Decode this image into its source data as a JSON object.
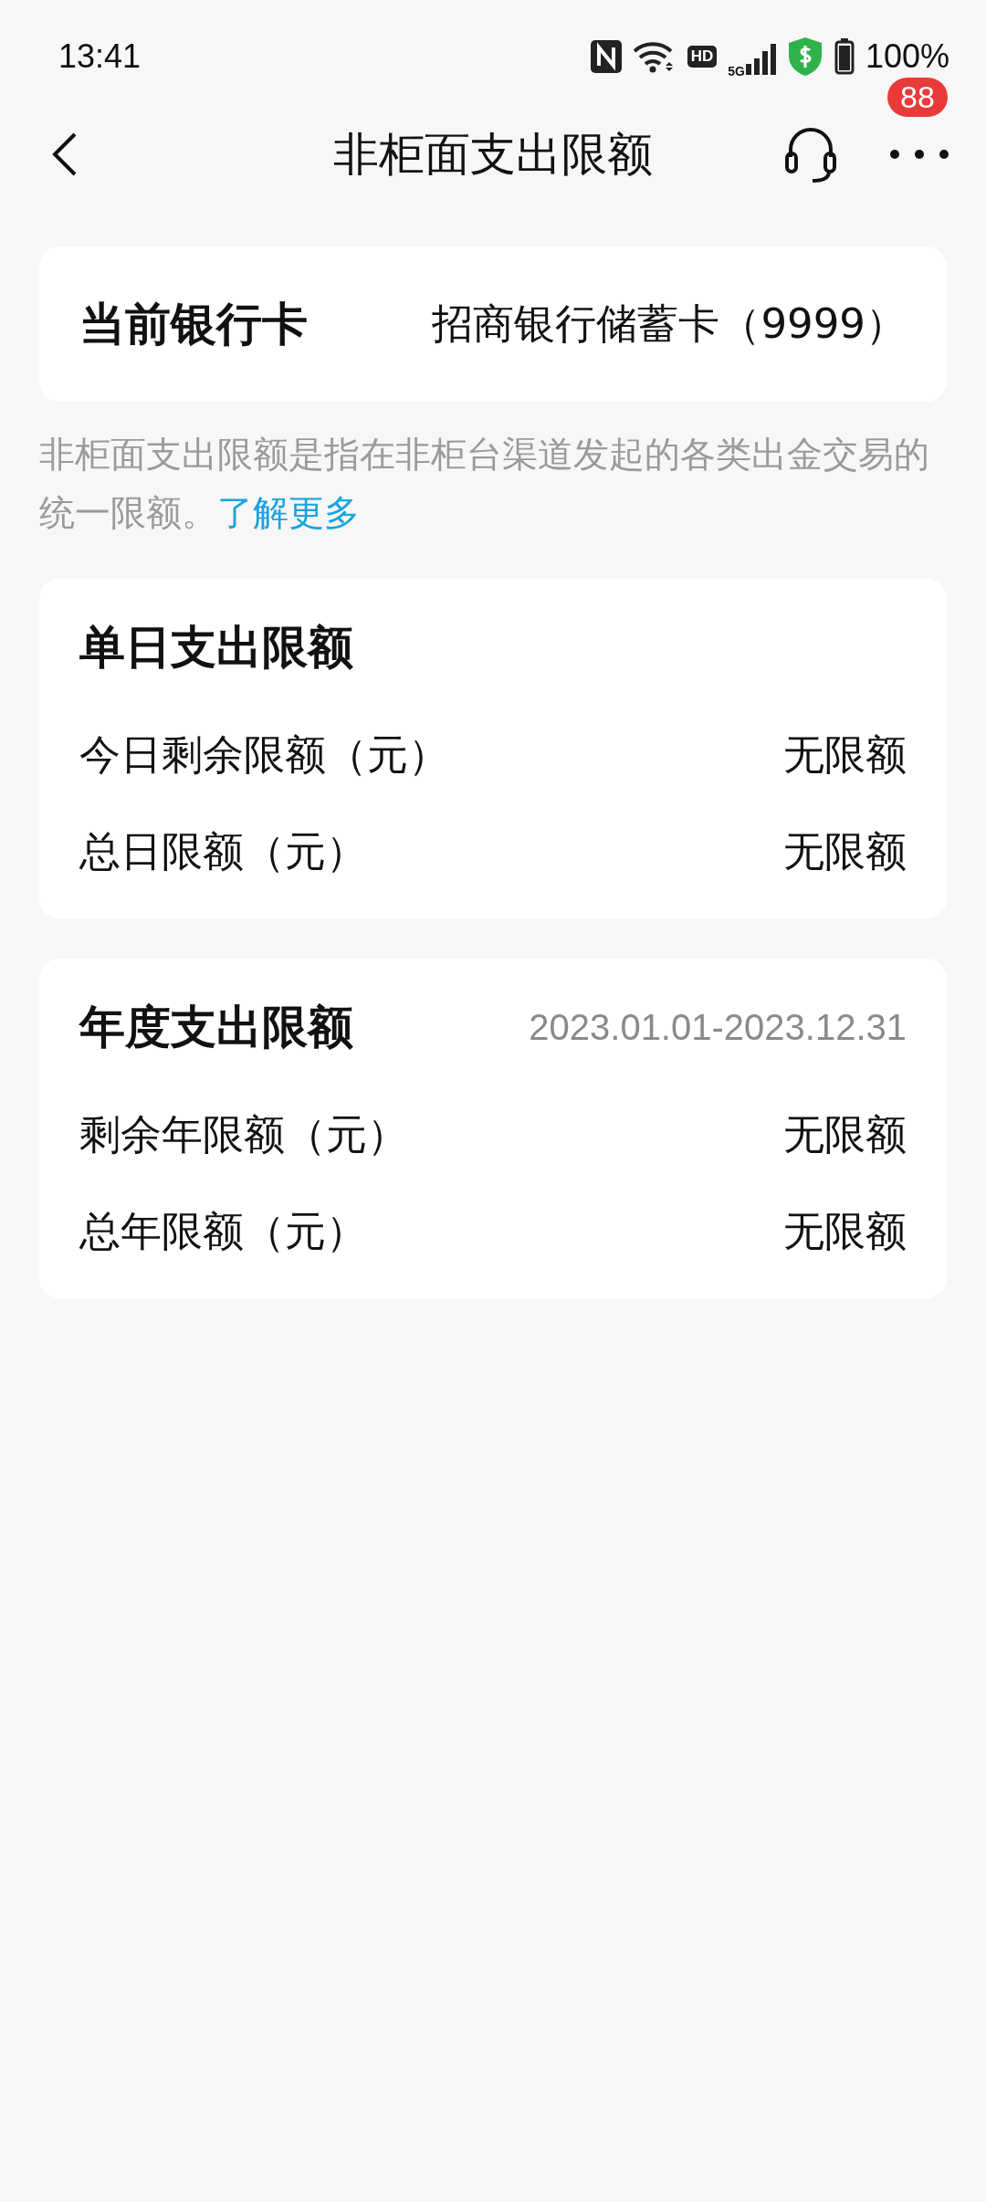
{
  "status_bar": {
    "time": "13:41",
    "hd": "HD",
    "network": "5G",
    "battery": "100%"
  },
  "header": {
    "title": "非柜面支出限额",
    "badge": "88"
  },
  "card_info": {
    "label": "当前银行卡",
    "value": "招商银行储蓄卡（9999）"
  },
  "description": {
    "text": "非柜面支出限额是指在非柜台渠道发起的各类出金交易的统一限额。",
    "link": "了解更多"
  },
  "sections": [
    {
      "title": "单日支出限额",
      "rows": [
        {
          "label": "今日剩余限额（元）",
          "value": "无限额"
        },
        {
          "label": "总日限额（元）",
          "value": "无限额"
        }
      ]
    },
    {
      "title": "年度支出限额",
      "period": "2023.01.01-2023.12.31",
      "rows": [
        {
          "label": "剩余年限额（元）",
          "value": "无限额"
        },
        {
          "label": "总年限额（元）",
          "value": "无限额"
        }
      ]
    }
  ]
}
